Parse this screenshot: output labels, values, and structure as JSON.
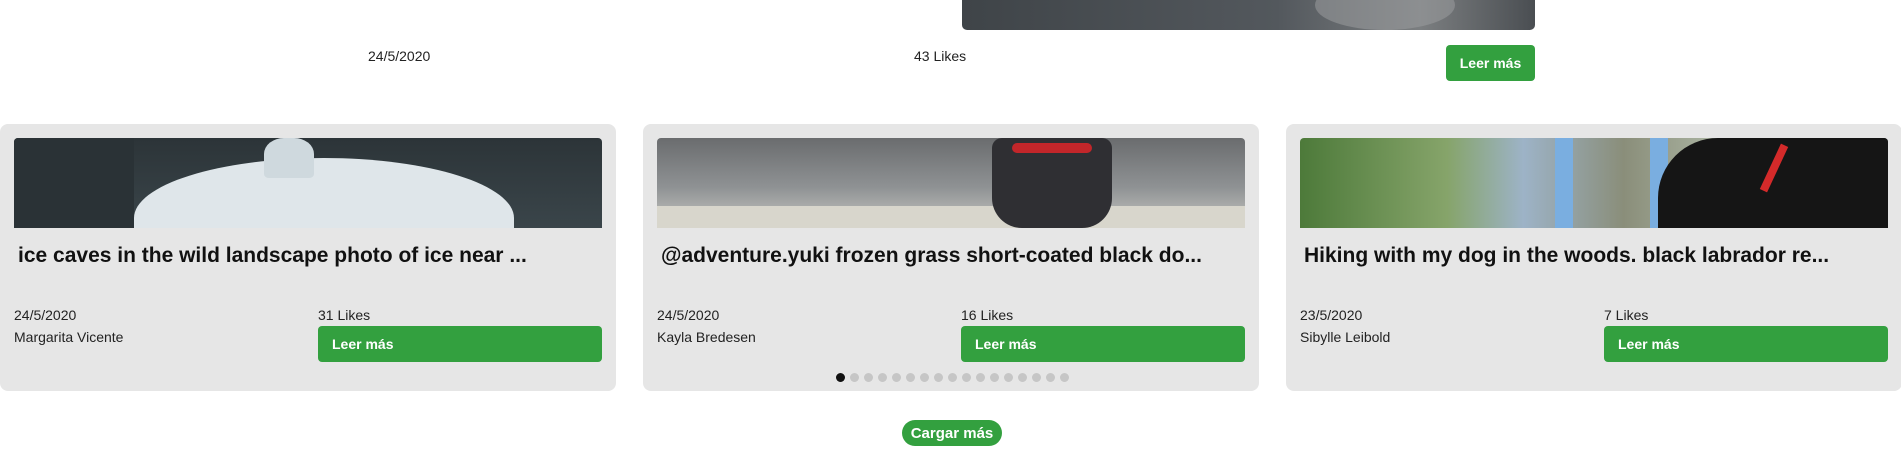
{
  "top_row": {
    "date": "24/5/2020",
    "likes": "43 Likes",
    "button_label": "Leer más"
  },
  "cards": [
    {
      "title": "ice caves in the wild landscape photo of ice near ...",
      "date": "24/5/2020",
      "author": "Margarita Vicente",
      "likes": "31 Likes",
      "button_label": "Leer más"
    },
    {
      "title": "@adventure.yuki frozen grass short-coated black do...",
      "date": "24/5/2020",
      "author": "Kayla Bredesen",
      "likes": "16 Likes",
      "button_label": "Leer más"
    },
    {
      "title": "Hiking with my dog in the woods. black labrador re...",
      "date": "23/5/2020",
      "author": "Sibylle Leibold",
      "likes": "7 Likes",
      "button_label": "Leer más"
    }
  ],
  "pagination": {
    "total_dots": 17,
    "active_index": 0
  },
  "load_more_label": "Cargar más",
  "colors": {
    "accent": "#33a03f",
    "card_bg": "#e6e6e6"
  }
}
